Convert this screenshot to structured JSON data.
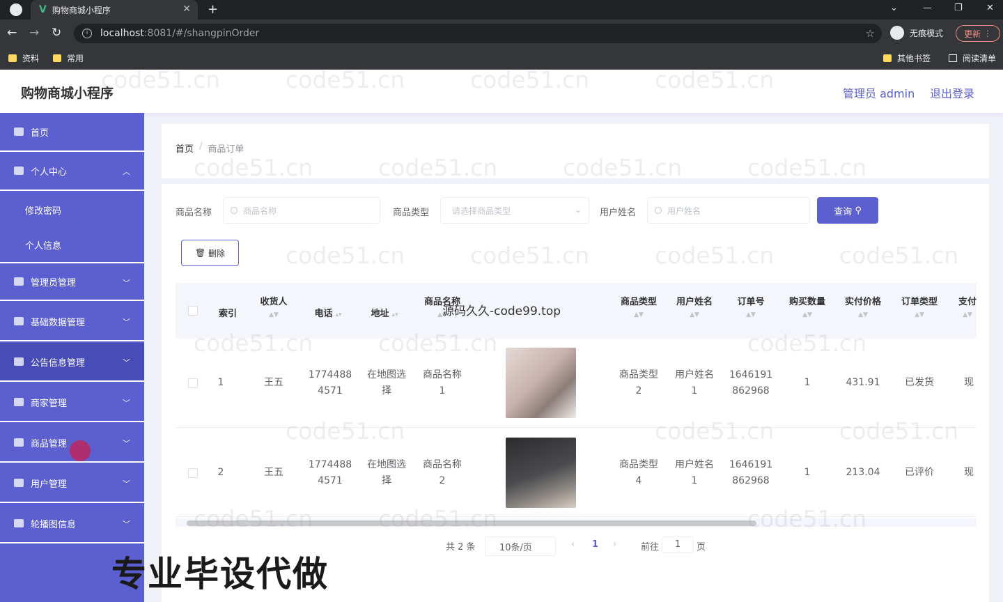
{
  "browser": {
    "tab_title": "购物商城小程序",
    "url_host": "localhost",
    "url_rest": ":8081/#/shangpinOrder",
    "incognito_label": "无痕模式",
    "update_label": "更新",
    "bookmarks": [
      "资料",
      "常用"
    ],
    "bookmarks_right": [
      "其他书签",
      "阅读清单"
    ]
  },
  "header": {
    "title": "购物商城小程序",
    "admin_label": "管理员 admin",
    "logout_label": "退出登录"
  },
  "sidebar": {
    "items": [
      {
        "label": "首页"
      },
      {
        "label": "个人中心"
      },
      {
        "label": "修改密码"
      },
      {
        "label": "个人信息"
      },
      {
        "label": "管理员管理"
      },
      {
        "label": "基础数据管理"
      },
      {
        "label": "公告信息管理"
      },
      {
        "label": "商家管理"
      },
      {
        "label": "商品管理"
      },
      {
        "label": "用户管理"
      },
      {
        "label": "轮播图信息"
      }
    ]
  },
  "breadcrumb": {
    "home": "首页",
    "sep": "/",
    "current": "商品订单"
  },
  "filters": {
    "name_label": "商品名称",
    "name_placeholder": "商品名称",
    "type_label": "商品类型",
    "type_placeholder": "请选择商品类型",
    "user_label": "用户姓名",
    "user_placeholder": "用户姓名",
    "search_label": "查询"
  },
  "actions": {
    "delete_label": "删除"
  },
  "table": {
    "columns": [
      "索引",
      "收货人",
      "电话",
      "地址",
      "商品名称",
      "商品类型",
      "用户姓名",
      "订单号",
      "购买数量",
      "实付价格",
      "订单类型",
      "支付"
    ],
    "rows": [
      {
        "index": "1",
        "receiver": "王五",
        "phone1": "1774488",
        "phone2": "4571",
        "addr1": "在地图选",
        "addr2": "择",
        "name1": "商品名称",
        "name2": "1",
        "type1": "商品类型",
        "type2": "2",
        "user1": "用户姓名",
        "user2": "1",
        "order1": "1646191",
        "order2": "862968",
        "qty": "1",
        "price": "431.91",
        "status": "已发货",
        "pay": "现"
      },
      {
        "index": "2",
        "receiver": "王五",
        "phone1": "1774488",
        "phone2": "4571",
        "addr1": "在地图选",
        "addr2": "择",
        "name1": "商品名称",
        "name2": "2",
        "type1": "商品类型",
        "type2": "4",
        "user1": "用户姓名",
        "user2": "1",
        "order1": "1646191",
        "order2": "862968",
        "qty": "1",
        "price": "213.04",
        "status": "已评价",
        "pay": "现"
      }
    ]
  },
  "pagination": {
    "total": "共 2 条",
    "page_size": "10条/页",
    "current_page": "1",
    "goto_label": "前往",
    "goto_value": "1",
    "page_suffix": "页"
  },
  "overlays": {
    "watermark": "code51.cn",
    "top_text": "源码久久-code99.top",
    "bottom_text": "专业毕设代做"
  },
  "colors": {
    "primary": "#5b5fcf",
    "sidebar": "#5b5fcf",
    "sidebar_active": "#484cb8"
  }
}
